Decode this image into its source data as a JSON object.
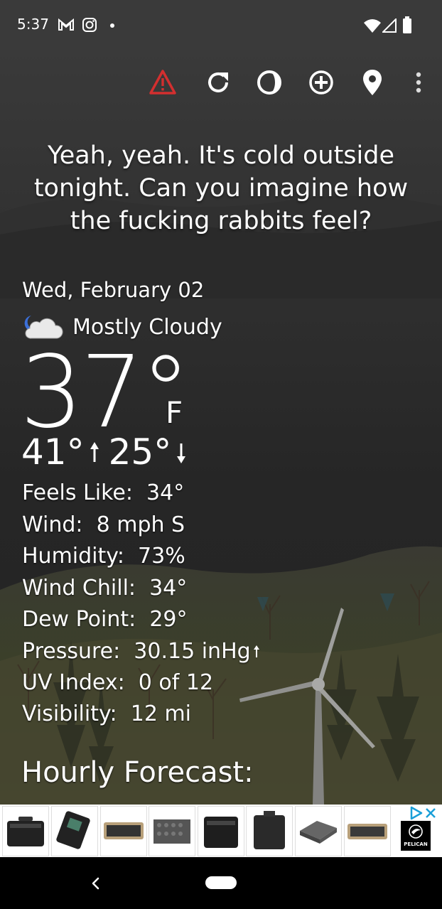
{
  "status_bar": {
    "time": "5:37",
    "icons": [
      "gmail-icon",
      "instagram-icon",
      "dot-icon",
      "wifi-icon",
      "signal-icon",
      "battery-icon"
    ]
  },
  "toolbar": {
    "buttons": [
      {
        "name": "alert-icon",
        "color": "#d32f2f"
      },
      {
        "name": "refresh-icon"
      },
      {
        "name": "moon-phase-icon"
      },
      {
        "name": "add-location-icon"
      },
      {
        "name": "location-pin-icon"
      },
      {
        "name": "more-vert-icon"
      }
    ]
  },
  "quote": "Yeah, yeah. It's cold outside tonight. Can you imagine how the fucking rabbits feel?",
  "weather": {
    "date": "Wed, February 02",
    "condition": "Mostly Cloudy",
    "condition_icon": "moon-cloud-icon",
    "temperature": "37°",
    "unit": "F",
    "high": "41°",
    "low": "25°",
    "details": [
      {
        "label": "Feels Like:",
        "value": "34°"
      },
      {
        "label": "Wind:",
        "value": "8 mph S"
      },
      {
        "label": "Humidity:",
        "value": "73%"
      },
      {
        "label": "Wind Chill:",
        "value": "34°"
      },
      {
        "label": "Dew Point:",
        "value": "29°"
      },
      {
        "label": "Pressure:",
        "value": "30.15 inHg"
      },
      {
        "label": "UV Index:",
        "value": "0 of 12"
      },
      {
        "label": "Visibility:",
        "value": "12 mi"
      }
    ],
    "pressure_trend": "rising"
  },
  "hourly_heading": "Hourly Forecast:",
  "ad": {
    "brand": "PELICAN",
    "product_count": 8
  },
  "nav": {
    "back": "back-icon",
    "home": "home-pill"
  }
}
